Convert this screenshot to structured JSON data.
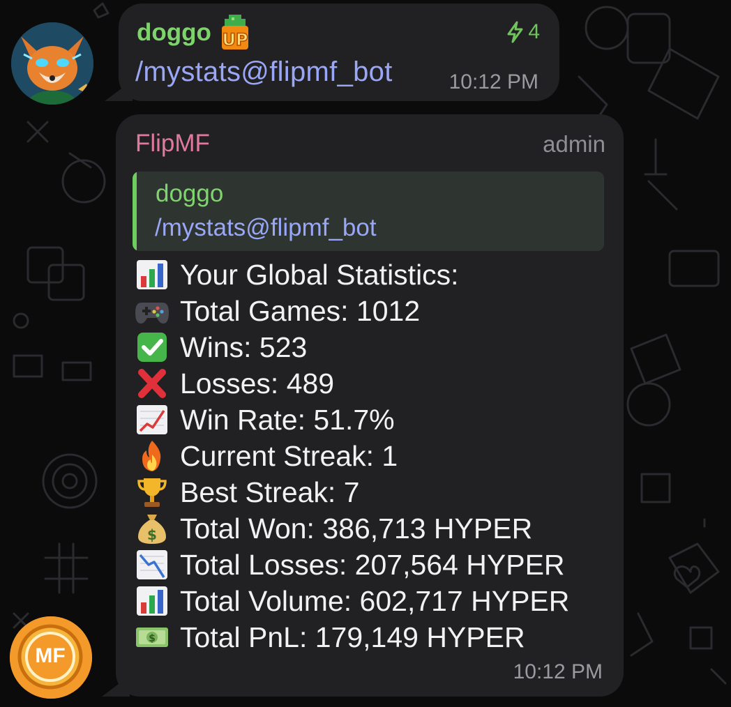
{
  "messages": [
    {
      "sender": "doggo",
      "badge": "UP",
      "boost_icon": "lightning-icon",
      "boost_count": "4",
      "text": "/mystats@flipmf_bot",
      "time": "10:12 PM"
    },
    {
      "sender": "FlipMF",
      "role": "admin",
      "reply": {
        "sender": "doggo",
        "text": "/mystats@flipmf_bot"
      },
      "stats": [
        {
          "icon": "bar-chart-icon",
          "text": "Your Global Statistics:"
        },
        {
          "icon": "game-controller-icon",
          "text": "Total Games: 1012"
        },
        {
          "icon": "check-mark-icon",
          "text": "Wins: 523"
        },
        {
          "icon": "cross-mark-icon",
          "text": "Losses: 489"
        },
        {
          "icon": "chart-increasing-icon",
          "text": "Win Rate: 51.7%"
        },
        {
          "icon": "fire-icon",
          "text": "Current Streak: 1"
        },
        {
          "icon": "trophy-icon",
          "text": "Best Streak: 7"
        },
        {
          "icon": "money-bag-icon",
          "text": "Total Won: 386,713 HYPER"
        },
        {
          "icon": "chart-decreasing-icon",
          "text": "Total Losses: 207,564 HYPER"
        },
        {
          "icon": "bar-chart-icon",
          "text": "Total Volume: 602,717 HYPER"
        },
        {
          "icon": "dollar-banknote-icon",
          "text": "Total PnL: 179,149 HYPER"
        }
      ],
      "time": "10:12 PM"
    }
  ],
  "avatars": {
    "bot_logo_text": "MF"
  },
  "colors": {
    "background": "#0b0b0c",
    "bubble": "#212123",
    "sender_green": "#7fd36d",
    "bot_pink": "#e07a9c",
    "command_blue": "#9aa7f7",
    "reply_bar": "#6fcd5f"
  }
}
